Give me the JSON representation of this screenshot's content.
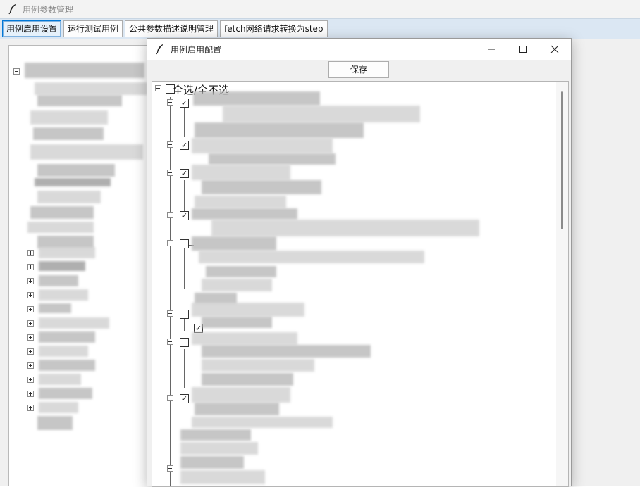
{
  "main_window": {
    "title": "用例参数管理"
  },
  "toolbar": {
    "buttons": [
      {
        "label": "用例启用设置",
        "active": true
      },
      {
        "label": "运行测试用例",
        "active": false
      },
      {
        "label": "公共参数描述说明管理",
        "active": false
      },
      {
        "label": "fetch网络请求转换为step",
        "active": false
      }
    ]
  },
  "dialog": {
    "title": "用例启用配置",
    "save_label": "保存",
    "tree": {
      "root_label": "全选/全不选",
      "root_checked": false
    }
  },
  "icons": {
    "app": "feather-icon",
    "minimize": "minimize-icon",
    "maximize": "maximize-icon",
    "close": "close-icon"
  },
  "colors": {
    "active_border": "#0078d7",
    "toolbar_bg": "#dbe7f3"
  }
}
